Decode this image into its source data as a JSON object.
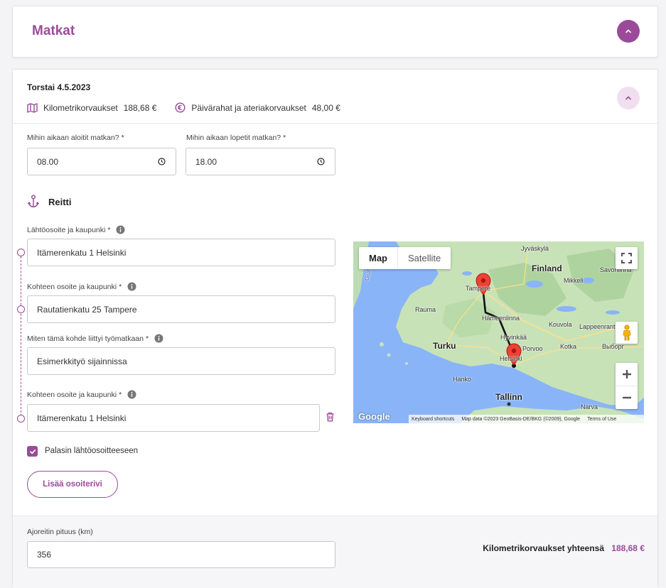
{
  "header": {
    "title": "Matkat"
  },
  "day": {
    "title": "Torstai 4.5.2023",
    "km_label": "Kilometrikorvaukset",
    "km_value": "188,68 €",
    "per_diem_label": "Päivärahat ja ateriakorvaukset",
    "per_diem_value": "48,00 €"
  },
  "times": {
    "start_label": "Mihin aikaan aloitit matkan?",
    "start_value": "08.00",
    "end_label": "Mihin aikaan lopetit matkan?",
    "end_value": "18.00",
    "required_mark": "*"
  },
  "route": {
    "title": "Reitti",
    "start_label": "Lähtöosoite ja kaupunki",
    "start_value": "Itämerenkatu 1 Helsinki",
    "dest_label": "Kohteen osoite ja kaupunki",
    "dest_value": "Rautatienkatu 25 Tampere",
    "purpose_label": "Miten tämä kohde liittyi työmatkaan",
    "purpose_value": "Esimerkkityö sijainnissa",
    "dest2_label": "Kohteen osoite ja kaupunki",
    "dest2_value": "Itämerenkatu 1 Helsinki",
    "returned_label": "Palasin lähtöosoitteeseen",
    "add_button": "Lisää osoiterivi"
  },
  "map": {
    "type_map": "Map",
    "type_satellite": "Satellite",
    "places": {
      "finland": "Finland",
      "tampere": "Tampere",
      "helsinki": "Helsinki",
      "turku": "Turku",
      "tallinn": "Tallinn",
      "rauma": "Rauma",
      "porvoo": "Porvoo",
      "kouvola": "Kouvola",
      "jyvaskyla": "Jyväskylä",
      "mikkeli": "Mikkeli",
      "savonlinna": "Savonlinna",
      "lappeenranta": "Lappeenranta",
      "hameenlinna": "Hämeenlinna",
      "hyvinkaa": "Hyvinkää",
      "kotka": "Kotka",
      "hanko": "Hanko",
      "narva": "Narva",
      "vyborg": "Выборг",
      "gulf": "Gulf"
    },
    "google": "Google",
    "shortcuts": "Keyboard shortcuts",
    "attribution": "Map data ©2023 GeoBasis-DE/BKG (©2009), Google",
    "terms": "Terms of Use"
  },
  "footer": {
    "length_label": "Ajoreitin pituus (km)",
    "length_value": "356",
    "total_label": "Kilometrikorvaukset yhteensä",
    "total_value": "188,68 €"
  }
}
